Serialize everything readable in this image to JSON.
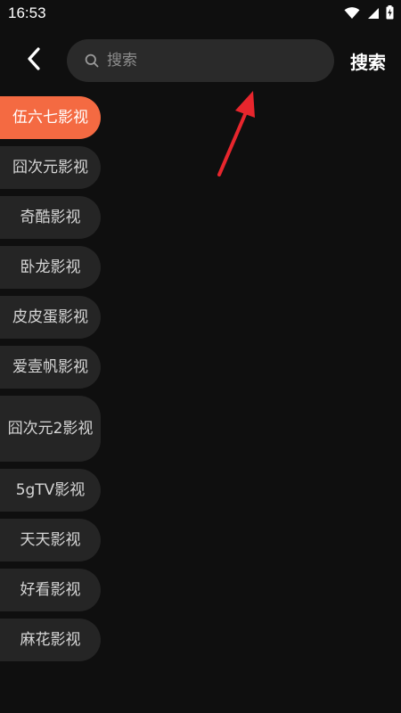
{
  "status_bar": {
    "time": "16:53"
  },
  "header": {
    "back_icon": "chevron-left-icon",
    "search": {
      "placeholder": "搜索",
      "value": ""
    },
    "search_button_label": "搜索"
  },
  "sidebar": {
    "items": [
      {
        "label": "伍六七影视",
        "active": true
      },
      {
        "label": "囧次元影视",
        "active": false
      },
      {
        "label": "奇酷影视",
        "active": false
      },
      {
        "label": "卧龙影视",
        "active": false
      },
      {
        "label": "皮皮蛋影视",
        "active": false
      },
      {
        "label": "爱壹帆影视",
        "active": false
      },
      {
        "label": "囧次元2影视",
        "active": false
      },
      {
        "label": "5gTV影视",
        "active": false
      },
      {
        "label": "天天影视",
        "active": false
      },
      {
        "label": "好看影视",
        "active": false
      },
      {
        "label": "麻花影视",
        "active": false
      }
    ]
  },
  "colors": {
    "background": "#0f0f0f",
    "accent": "#f46a42",
    "item_background": "#252525",
    "search_background": "#2a2a2a",
    "annotation": "#e8262d"
  }
}
